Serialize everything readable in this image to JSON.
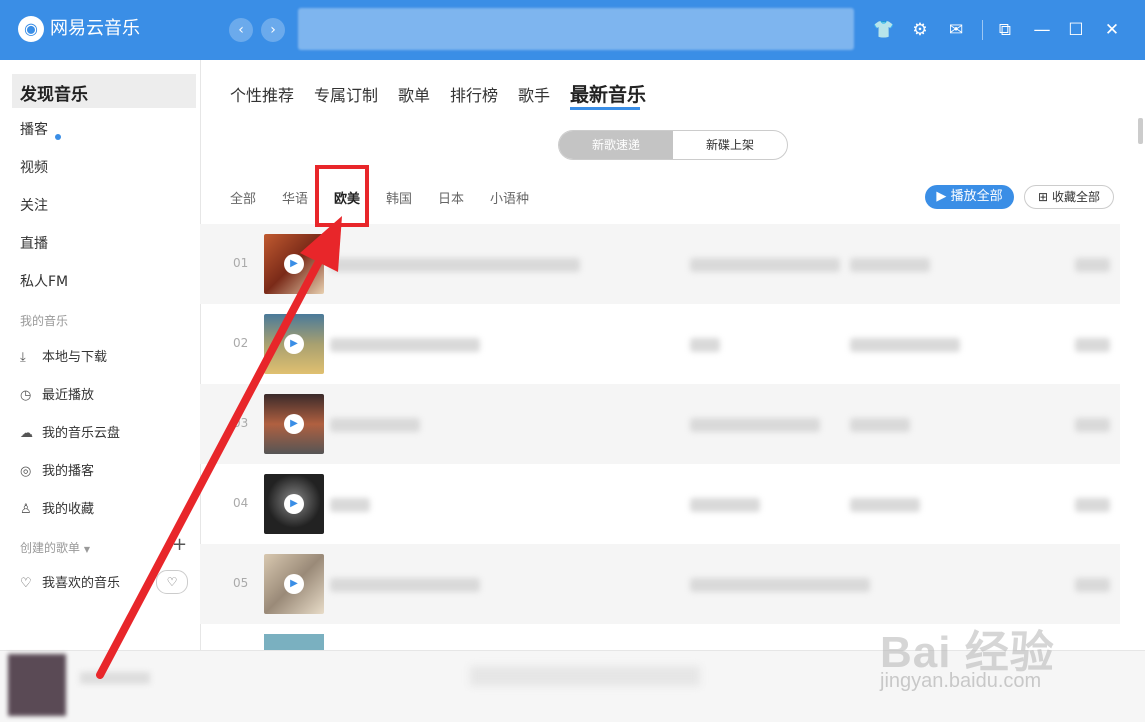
{
  "app": {
    "title": "网易云音乐",
    "logo_icon": "netease-logo-icon",
    "accent": "#3a8ee6"
  },
  "titlebar": {
    "back_icon": "‹",
    "forward_icon": "›",
    "icons": {
      "skin": "👕",
      "settings": "⚙",
      "mail": "✉",
      "mini": "⧉",
      "minimize": "—",
      "maximize": "☐",
      "close": "✕"
    }
  },
  "sidebar": {
    "discover": "发现音乐",
    "items": [
      "播客",
      "视频",
      "关注",
      "直播",
      "私人FM"
    ],
    "my_music_label": "我的音乐",
    "my_music": [
      {
        "label": "本地与下载",
        "icon": "⤓"
      },
      {
        "label": "最近播放",
        "icon": "◷"
      },
      {
        "label": "我的音乐云盘",
        "icon": "☁"
      },
      {
        "label": "我的播客",
        "icon": "◎"
      },
      {
        "label": "我的收藏",
        "icon": "♙"
      }
    ],
    "created_label": "创建的歌单",
    "add": "+",
    "favorite": {
      "label": "我喜欢的音乐",
      "icon": "♡"
    },
    "heart_mode": "♡"
  },
  "main": {
    "tabs": [
      "个性推荐",
      "专属订制",
      "歌单",
      "排行榜",
      "歌手",
      "最新音乐"
    ],
    "toggle": [
      "新歌速递",
      "新碟上架"
    ],
    "filters": [
      "全部",
      "华语",
      "欧美",
      "韩国",
      "日本",
      "小语种"
    ],
    "play_all": "播放全部",
    "collect_all": "收藏全部",
    "songs": [
      {
        "num": "01",
        "cover_color": "#a04020"
      },
      {
        "num": "02",
        "cover_color": "#5a8aa0"
      },
      {
        "num": "03",
        "cover_color": "#6a4a40"
      },
      {
        "num": "04",
        "cover_color": "#2a2a2a"
      },
      {
        "num": "05",
        "cover_color": "#c8b8a0"
      }
    ]
  },
  "watermark": {
    "main": "Bai 经验",
    "sub": "jingyan.baidu.com"
  }
}
